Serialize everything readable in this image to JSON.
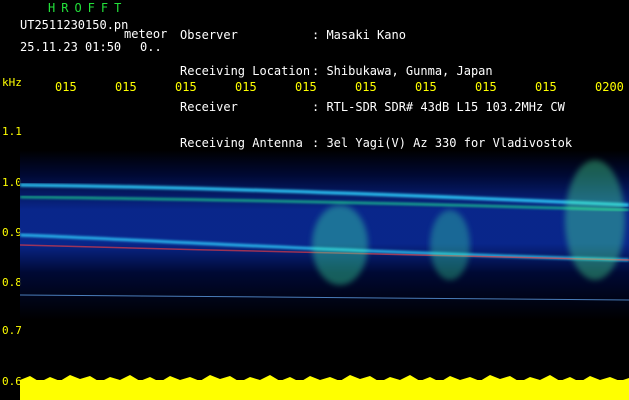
{
  "app": {
    "name": "HROFFT",
    "filename": "UT2511230150.pn",
    "mode": "meteor",
    "datetime": "25.11.23 01:50",
    "counter": "0.."
  },
  "info": {
    "rows": [
      {
        "label": "Observer",
        "value": ": Masaki Kano"
      },
      {
        "label": "Receiving Location",
        "value": ": Shibukawa, Gunma, Japan"
      },
      {
        "label": "Receiver",
        "value": ": RTL-SDR SDR# 43dB L15 103.2MHz CW"
      },
      {
        "label": "Receiving Antenna",
        "value": ": 3el Yagi(V) Az 330 for Vladivostok"
      }
    ]
  },
  "axes": {
    "freq_unit": "kHz",
    "freq_ticks": [
      "1.1",
      "1.0",
      "0.9",
      "0.8",
      "0.7",
      "0.6"
    ],
    "time_ticks": [
      "015",
      "015",
      "015",
      "015",
      "015",
      "015",
      "015",
      "015",
      "015",
      "0200"
    ]
  },
  "colors": {
    "background": "#000000",
    "axis_text": "#ffff00",
    "title_green": "#22e03a",
    "power_yellow": "#ffff00"
  }
}
